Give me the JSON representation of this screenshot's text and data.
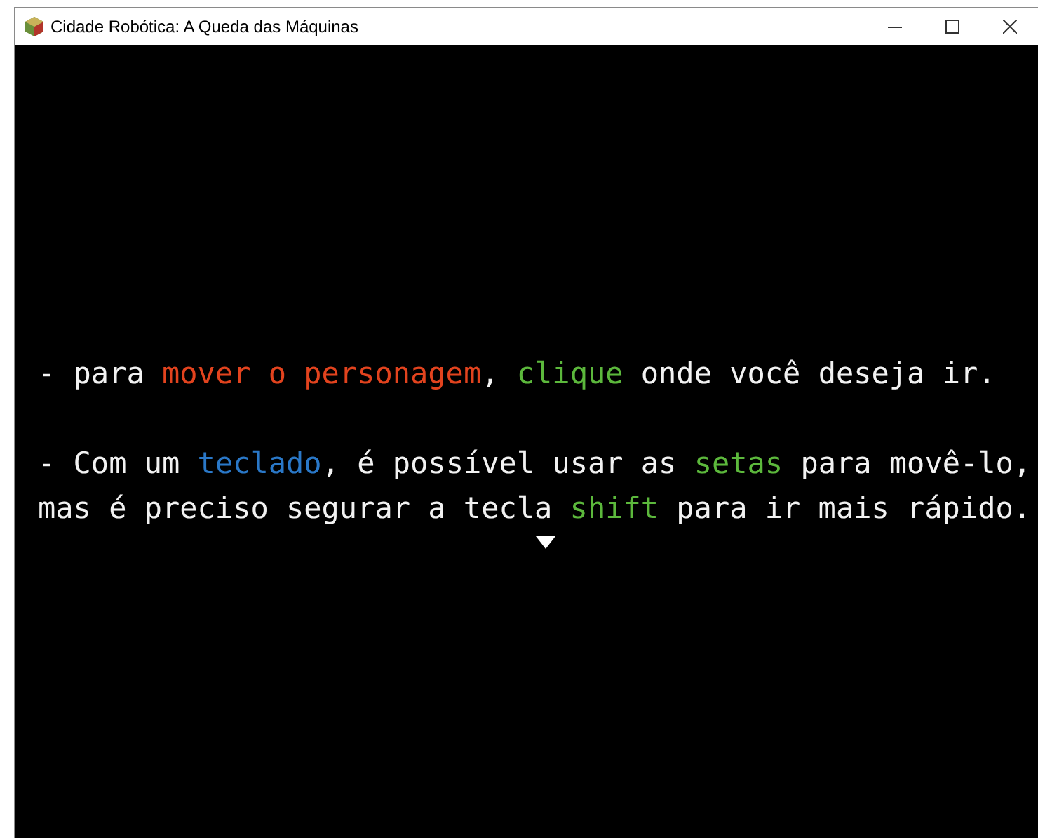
{
  "window": {
    "title": "Cidade Robótica: A Queda das Máquinas"
  },
  "dialog": {
    "paragraphs": [
      {
        "lines": [
          [
            {
              "text": "- para "
            },
            {
              "text": "mover o personagem",
              "color": "#e2431e"
            },
            {
              "text": ", "
            },
            {
              "text": "clique",
              "color": "#5cb83c"
            },
            {
              "text": " onde você deseja ir."
            }
          ]
        ]
      },
      {
        "lines": [
          [
            {
              "text": "- Com um "
            },
            {
              "text": "teclado",
              "color": "#2a78c8"
            },
            {
              "text": ", é possível usar as "
            },
            {
              "text": "setas",
              "color": "#5cb83c"
            },
            {
              "text": " para movê-lo,"
            }
          ],
          [
            {
              "text": "mas é preciso segurar a tecla "
            },
            {
              "text": "shift",
              "color": "#5cb83c"
            },
            {
              "text": " para ir mais rápido."
            }
          ]
        ]
      }
    ],
    "continue_indicator": true
  }
}
